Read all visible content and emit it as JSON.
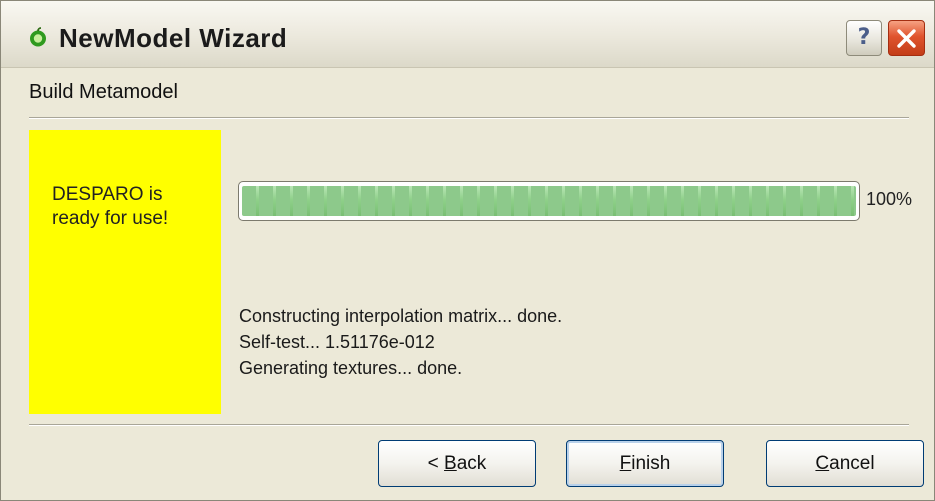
{
  "window": {
    "title": "NewModel Wizard",
    "app_icon": "green-apple-icon",
    "controls": {
      "help_label": "?",
      "help_icon": "help-icon",
      "close_icon": "close-icon"
    }
  },
  "step": {
    "title": "Build Metamodel"
  },
  "side_panel": {
    "message": "DESPARO is ready for use!",
    "background": "#ffff00"
  },
  "progress": {
    "value": 1.0,
    "label": "100%"
  },
  "log": {
    "lines": [
      "Constructing interpolation matrix... done.",
      "Self-test... 1.51176e-012",
      "Generating textures... done."
    ]
  },
  "buttons": {
    "back": {
      "prefix": "< ",
      "mnemonic": "B",
      "rest": "ack"
    },
    "finish": {
      "prefix": "",
      "mnemonic": "F",
      "rest": "inish"
    },
    "cancel": {
      "prefix": "",
      "mnemonic": "C",
      "rest": "ancel"
    }
  },
  "colors": {
    "progress_green": "#8fd08a",
    "close_red": "#e0542e",
    "panel_yellow": "#ffff00"
  }
}
